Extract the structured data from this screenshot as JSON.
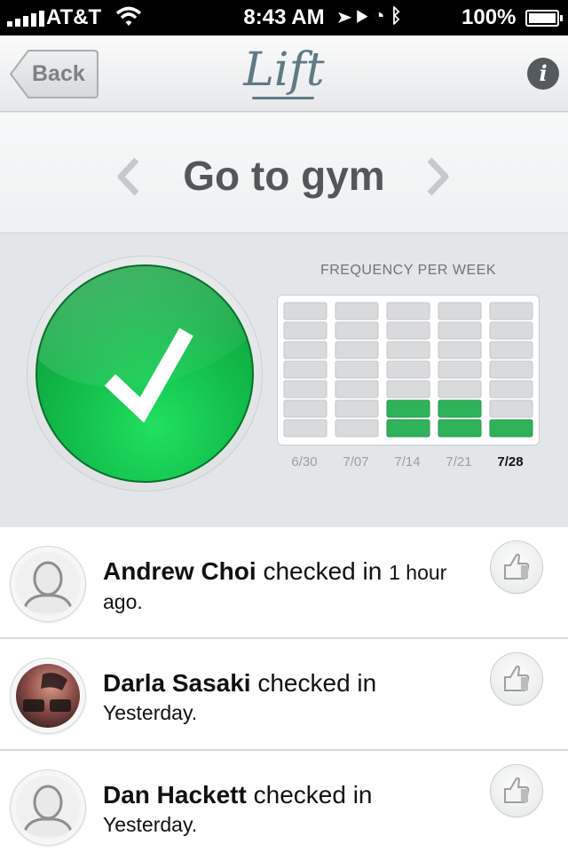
{
  "status_bar": {
    "carrier": "AT&T",
    "time": "8:43 AM",
    "battery": "100%",
    "icons": [
      "signal-icon",
      "wifi-icon",
      "location-icon",
      "play-icon",
      "alarm-icon",
      "bluetooth-icon",
      "battery-icon"
    ]
  },
  "nav": {
    "back_label": "Back",
    "logo": "Lift",
    "info_label": "i"
  },
  "habit": {
    "title": "Go to gym"
  },
  "frequency": {
    "title": "FREQUENCY PER WEEK",
    "accent_color": "#2fb35a",
    "current_week": "7/28"
  },
  "chart_data": {
    "type": "bar",
    "title": "FREQUENCY PER WEEK",
    "categories": [
      "6/30",
      "7/07",
      "7/14",
      "7/21",
      "7/28"
    ],
    "values": [
      0,
      0,
      2,
      2,
      1
    ],
    "ylim": [
      0,
      7
    ]
  },
  "feed": [
    {
      "name": "Andrew Choi",
      "action": "checked in",
      "time": "1 hour ago.",
      "avatar": "default-avatar-icon"
    },
    {
      "name": "Darla Sasaki",
      "action": "checked in",
      "time": "Yesterday.",
      "avatar": "photo"
    },
    {
      "name": "Dan Hackett",
      "action": "checked in",
      "time": "Yesterday.",
      "avatar": "default-avatar-icon"
    }
  ]
}
